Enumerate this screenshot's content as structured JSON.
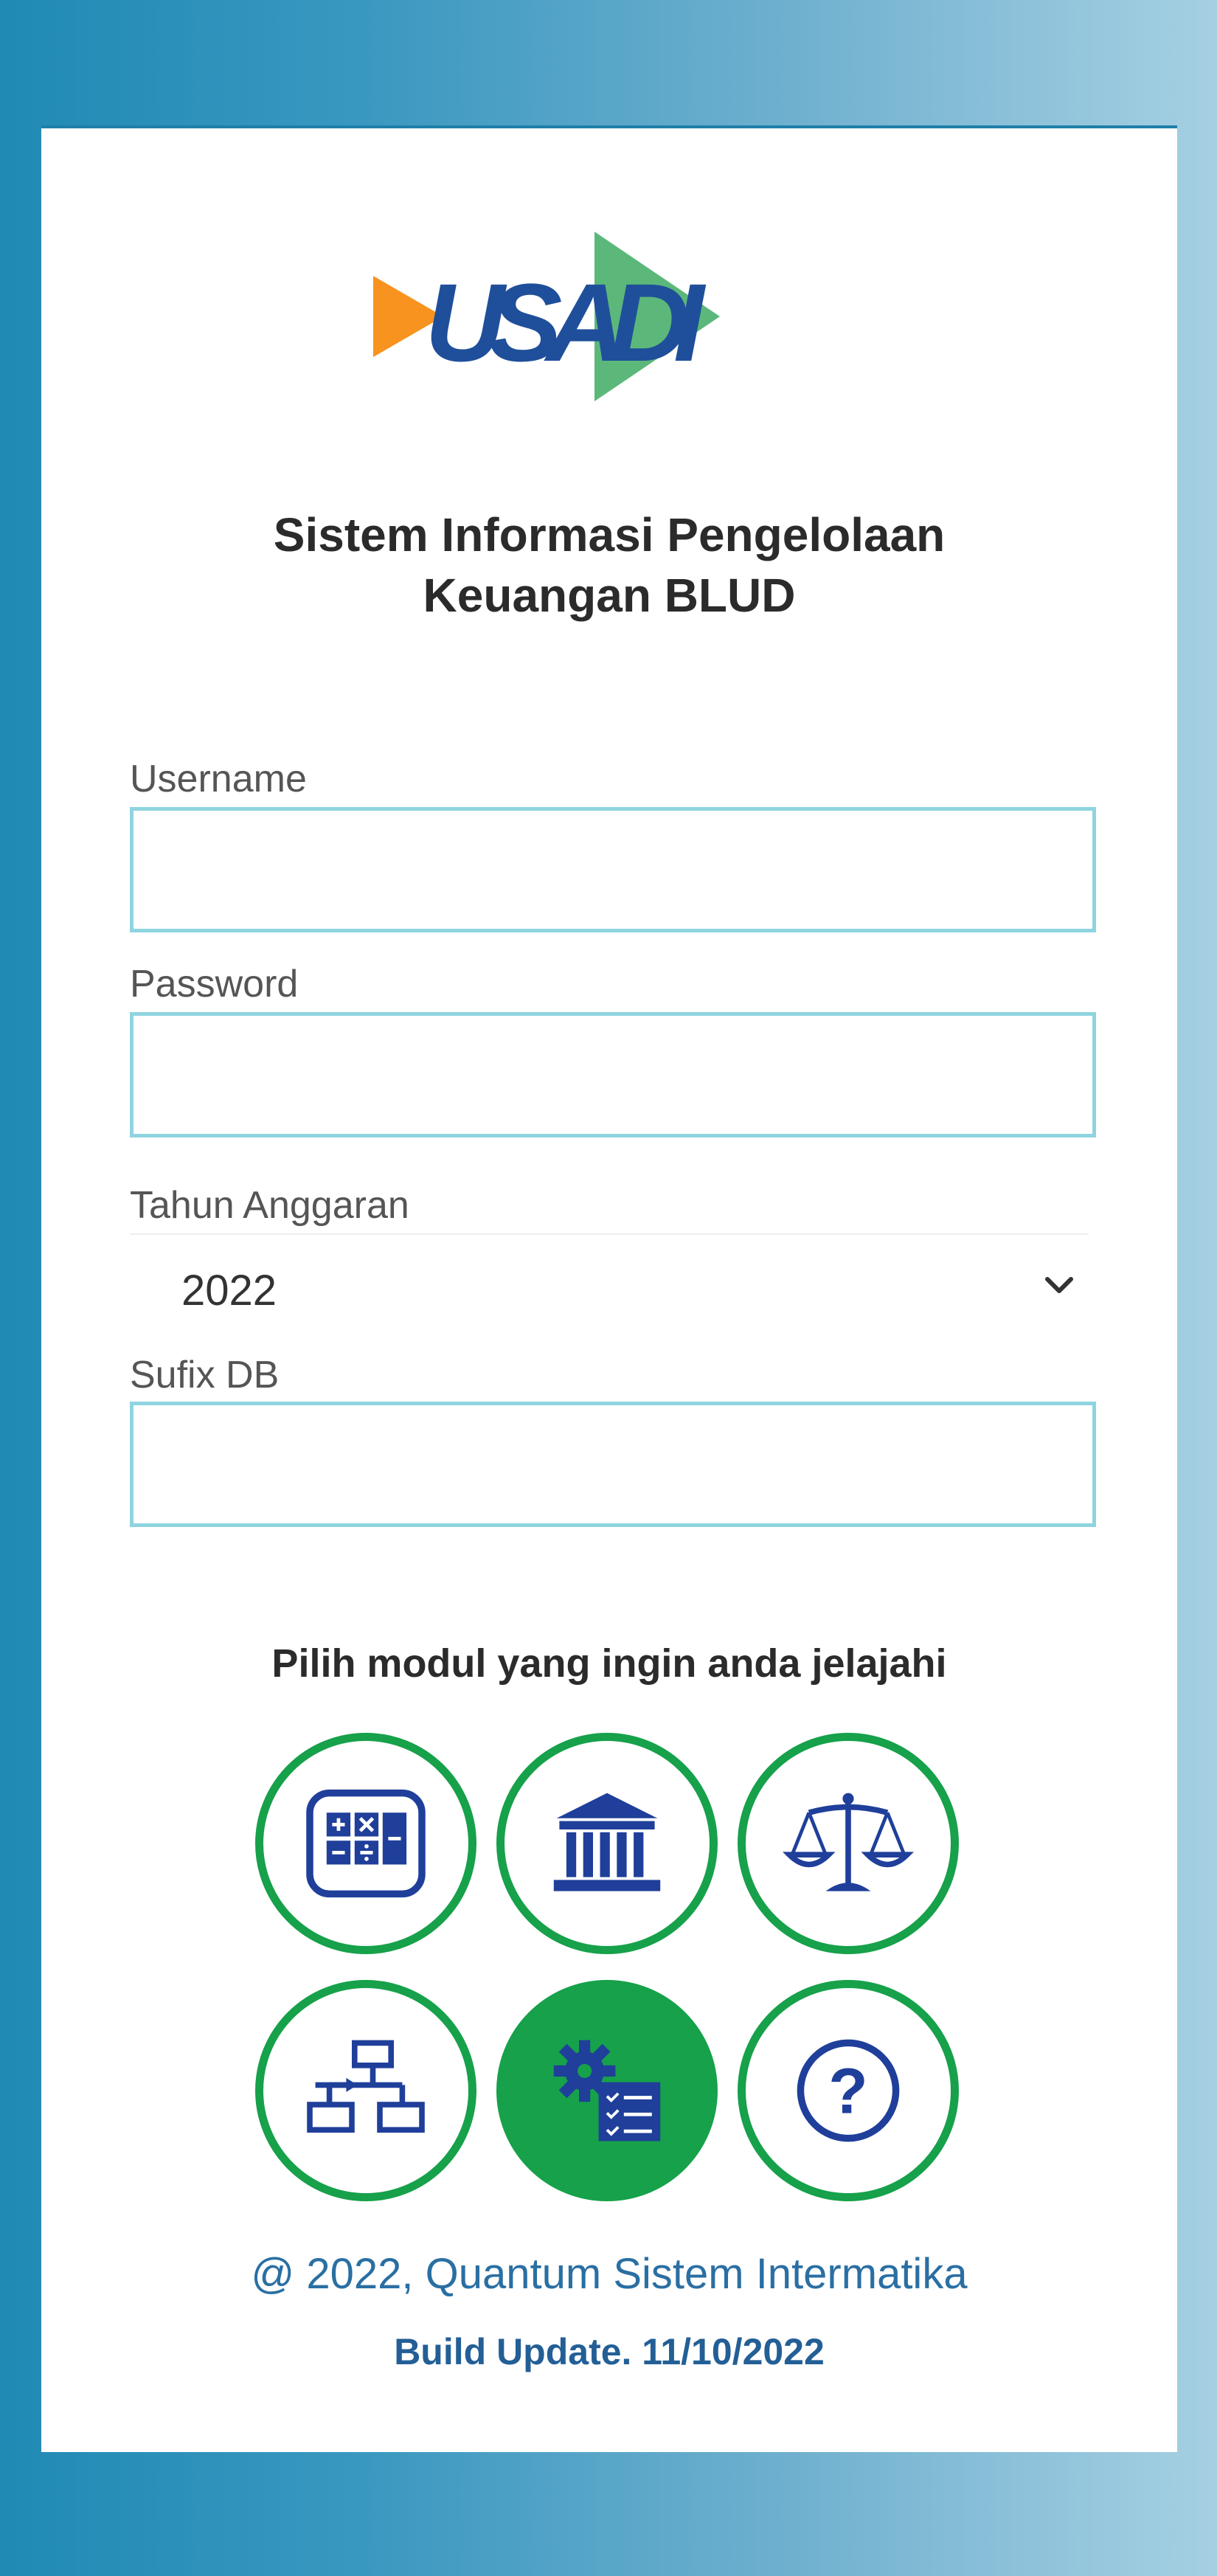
{
  "header": {
    "logo_text": "USADI",
    "title_line1": "Sistem Informasi Pengelolaan",
    "title_line2": "Keuangan BLUD"
  },
  "form": {
    "username_label": "Username",
    "username_value": "",
    "password_label": "Password",
    "password_value": "",
    "tahun_label": "Tahun Anggaran",
    "tahun_value": "2022",
    "sufix_label": "Sufix DB",
    "sufix_value": ""
  },
  "modules": {
    "heading": "Pilih modul yang ingin anda jelajahi",
    "items": [
      {
        "icon": "calculator-icon",
        "active": false
      },
      {
        "icon": "bank-building-icon",
        "active": false
      },
      {
        "icon": "balance-scale-icon",
        "active": false
      },
      {
        "icon": "flowchart-icon",
        "active": false
      },
      {
        "icon": "settings-checklist-icon",
        "active": true
      },
      {
        "icon": "help-question-icon",
        "active": false
      }
    ]
  },
  "footer": {
    "copyright": "@ 2022, Quantum Sistem Intermatika",
    "build": "Build Update. 11/10/2022"
  },
  "colors": {
    "accent_green": "#16a14a",
    "icon_blue": "#1f3f9a",
    "input_border": "#8fd4e0",
    "logo_orange": "#f7931e"
  }
}
